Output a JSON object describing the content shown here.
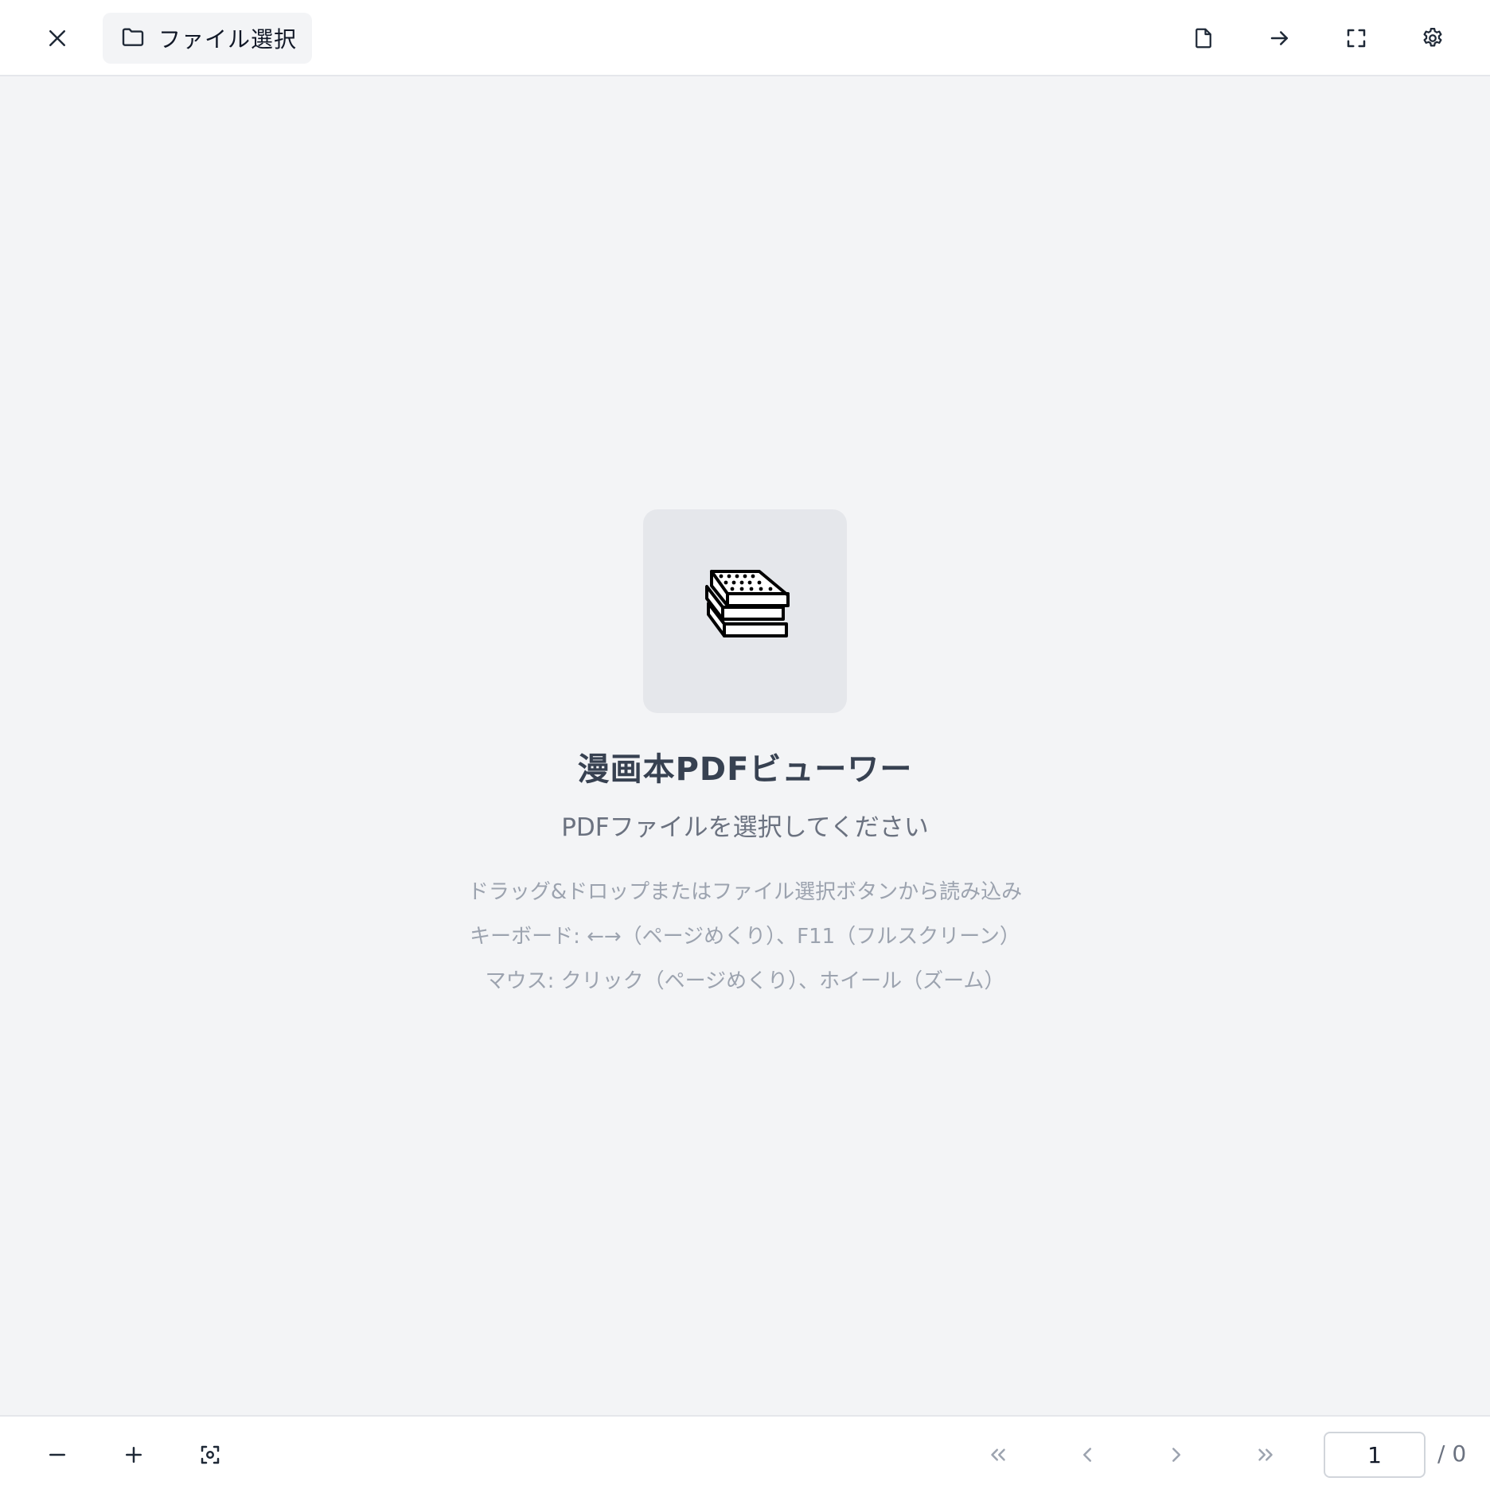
{
  "toolbar": {
    "file_select_label": "ファイル選択"
  },
  "welcome": {
    "title": "漫画本PDFビューワー",
    "subtitle": "PDFファイルを選択してください",
    "hints": [
      "ドラッグ&ドロップまたはファイル選択ボタンから読み込み",
      "キーボード: ←→（ページめくり）、F11（フルスクリーン）",
      "マウス: クリック（ページめくり）、ホイール（ズーム）"
    ]
  },
  "pager": {
    "current_page": "1",
    "total_label": "/ 0"
  },
  "icons": {
    "close": "close-icon",
    "folder": "folder-icon",
    "file": "file-icon",
    "arrow": "arrow-right-icon",
    "fullscreen": "fullscreen-icon",
    "settings": "gear-icon",
    "logo": "books-stack-icon",
    "zoom_out": "minus-icon",
    "zoom_in": "plus-icon",
    "fit": "focus-icon",
    "first": "chevrons-left-icon",
    "prev": "chevron-left-icon",
    "next": "chevron-right-icon",
    "last": "chevrons-right-icon"
  },
  "colors": {
    "background": "#f3f4f6",
    "bar": "#ffffff",
    "title": "#374151",
    "subtitle": "#6b7280",
    "hint": "#9ca3af"
  }
}
